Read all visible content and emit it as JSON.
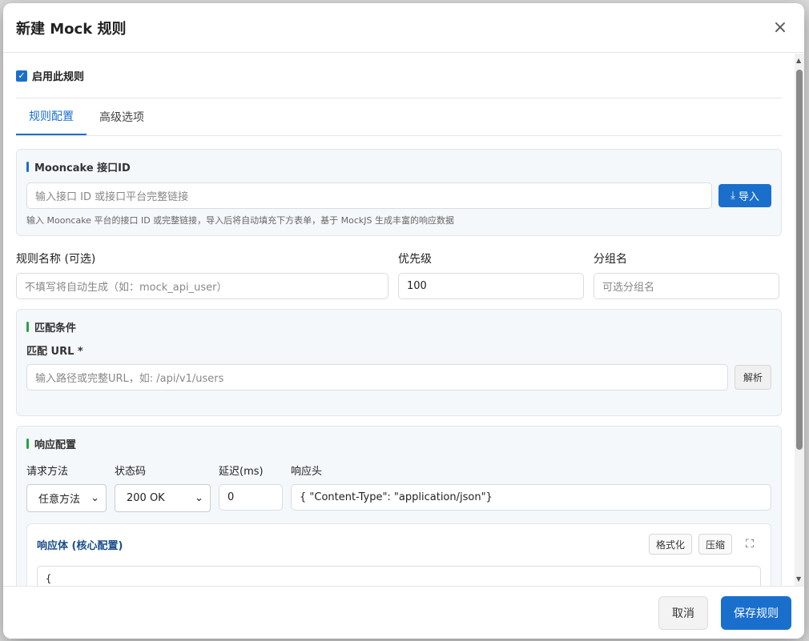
{
  "dialog": {
    "title": "新建 Mock 规则",
    "close_icon": "×"
  },
  "enable": {
    "checked": true,
    "label": "启用此规则"
  },
  "tabs": [
    {
      "label": "规则配置",
      "active": true
    },
    {
      "label": "高级选项",
      "active": false
    }
  ],
  "mooncake": {
    "title": "Mooncake 接口ID",
    "placeholder": "输入接口 ID 或接口平台完整链接",
    "import_label": "导入",
    "hint": "输入 Mooncake 平台的接口 ID 或完整链接，导入后将自动填充下方表单，基于 MockJS 生成丰富的响应数据"
  },
  "rule": {
    "name_label": "规则名称 (可选)",
    "name_placeholder": "不填写将自动生成（如：mock_api_user）",
    "priority_label": "优先级",
    "priority_value": "100",
    "group_label": "分组名",
    "group_placeholder": "可选分组名"
  },
  "match": {
    "title": "匹配条件",
    "url_label": "匹配 URL *",
    "url_placeholder": "输入路径或完整URL，如: /api/v1/users",
    "parse_label": "解析"
  },
  "response": {
    "title": "响应配置",
    "method_label": "请求方法",
    "method_value": "任意方法",
    "status_label": "状态码",
    "status_value": "200 OK",
    "delay_label": "延迟(ms)",
    "delay_value": "0",
    "headers_label": "响应头",
    "headers_value": "{  \"Content-Type\": \"application/json\"}",
    "body_title": "响应体 (核心配置)",
    "format_label": "格式化",
    "compress_label": "压缩",
    "body_value": "{"
  },
  "footer": {
    "cancel_label": "取消",
    "save_label": "保存规则"
  },
  "colors": {
    "primary": "#1a6fcc",
    "accent_green": "#2aa148"
  }
}
